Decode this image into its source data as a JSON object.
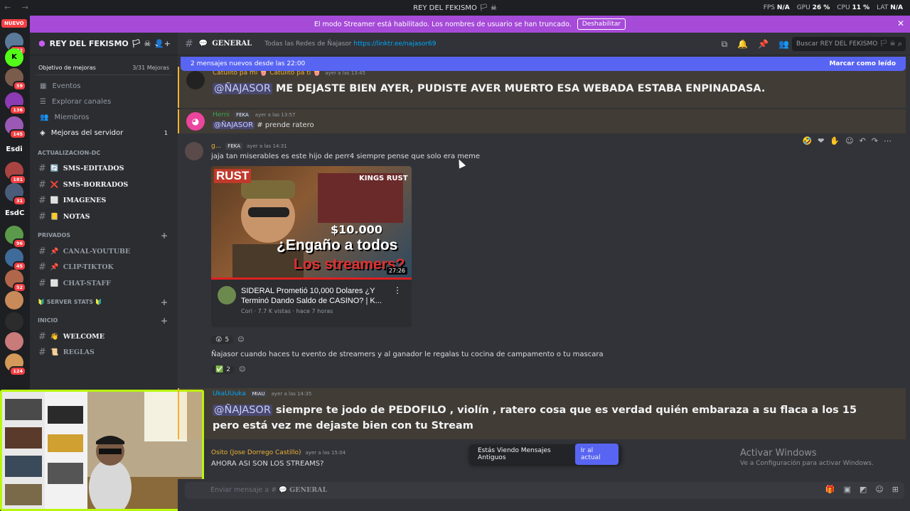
{
  "window": {
    "title": "REY DEL FEKISMO 🏳 ☠",
    "nav": "← →",
    "stats": [
      {
        "k": "FPS",
        "v": "N/A"
      },
      {
        "k": "GPU",
        "v": "26 %"
      },
      {
        "k": "CPU",
        "v": "11 %"
      },
      {
        "k": "LAT",
        "v": "N/A"
      }
    ]
  },
  "banner": {
    "text": "El modo Streamer está habilitado. Los nombres de usuario se han truncado.",
    "button": "Deshabilitar",
    "close": "✕"
  },
  "guilds": {
    "new_label": "NUEVO",
    "items": [
      {
        "badge": "232",
        "color": "#5b7a9a"
      },
      {
        "badge": "",
        "color": "#53fc18",
        "text": "K"
      },
      {
        "badge": "59",
        "color": "#7a5c4c"
      },
      {
        "badge": "136",
        "color": "#8b3bb3"
      },
      {
        "badge": "145",
        "color": "#9b59b6"
      },
      {
        "badge": "",
        "color": "",
        "text": "Esdi"
      },
      {
        "badge": "181",
        "color": "#a94442"
      },
      {
        "badge": "31",
        "color": "#4b5b7a"
      },
      {
        "badge": "",
        "color": "",
        "text": "EsdC"
      },
      {
        "badge": "96",
        "color": "#5a9a4a"
      },
      {
        "badge": "45",
        "color": "#3f6b9a"
      },
      {
        "badge": "52",
        "color": "#b0664a"
      },
      {
        "badge": "",
        "color": "#c98a5a"
      },
      {
        "badge": "",
        "color": "#2c2c2c"
      },
      {
        "badge": "",
        "color": "#c97a7a"
      },
      {
        "badge": "124",
        "color": "#d49a5a"
      }
    ]
  },
  "sidebar": {
    "server_name": "REY DEL FEKISMO 🏳 ☠",
    "boost_goal": "Objetivo de mejoras",
    "boost_count": "3/31 Mejoras",
    "nav": [
      {
        "label": "Eventos",
        "icon": "calendar-icon",
        "glyph": "▦"
      },
      {
        "label": "Explorar canales",
        "icon": "browse-icon",
        "glyph": "☰"
      },
      {
        "label": "Miembros",
        "icon": "members-icon",
        "glyph": "👥"
      },
      {
        "label": "Mejoras del servidor",
        "icon": "boost-icon",
        "glyph": "◈",
        "count": "1"
      }
    ],
    "categories": [
      {
        "name": "ACTUALIZACION-DC",
        "channels": [
          {
            "name": "SMS-EDITADOS",
            "emoji": "🔄",
            "unread": true
          },
          {
            "name": "SMS-BORRADOS",
            "emoji": "❌",
            "unread": true
          },
          {
            "name": "IMAGENES",
            "emoji": "⬜",
            "unread": true
          },
          {
            "name": "NOTAS",
            "emoji": "📒",
            "unread": true
          }
        ]
      },
      {
        "name": "PRIVADOS",
        "channels": [
          {
            "name": "CANAL-YOUTUBE",
            "emoji": "📌",
            "unread": false
          },
          {
            "name": "CLIP-TIKTOK",
            "emoji": "📌",
            "unread": false
          },
          {
            "name": "CHAT-STAFF",
            "emoji": "⬜",
            "unread": false
          }
        ]
      },
      {
        "name": "🔰 SERVER STATS 🔰",
        "channels": []
      },
      {
        "name": "INICIO",
        "channels": [
          {
            "name": "WELCOME",
            "emoji": "👋",
            "unread": true
          },
          {
            "name": "REGLAS",
            "emoji": "📜",
            "unread": false
          }
        ]
      }
    ]
  },
  "header": {
    "channel": "GENERAL",
    "topic": "Todas las Redes de Ñajasor",
    "link": "https://linktr.ee/najasor69",
    "search": "Buscar REY DEL FEKISMO 🏳 ☠"
  },
  "new_messages": {
    "text": "2 mensajes nuevos desde las 22:00",
    "action": "Marcar como leído"
  },
  "messages": [
    {
      "author": "Catulito pa mi 🍿 Catulito pa ti 🍿",
      "time": "ayer a las 13:45",
      "mention": "@ÑAJASOR",
      "text": "ME DEJASTE BIEN AYER, PUDISTE AVER MUERTO ESA WEBADA ESTABA ENPINADASA."
    },
    {
      "author": "Herni",
      "tag": "FEKA",
      "time": "ayer a las 13:57",
      "mention": "@ÑAJASOR",
      "text": "# prende ratero"
    },
    {
      "author": "g...",
      "tag": "FEKA",
      "time": "ayer a las 14:31",
      "text": "jaja tan miserables es este hijo de perr4 siempre pense que solo era meme"
    },
    {
      "text": "Ñajasor cuando haces tu evento de streamers y al ganador le regalas tu cocina de campamento o tu mascara"
    },
    {
      "author": "UkaUUuka",
      "tag": "MIAU",
      "time": "ayer a las 14:35",
      "mention": "@ÑAJASOR",
      "text": "siempre te jodo de PEDOFILO , violín , ratero cosa que es verdad quién embaraza a su flaca a los 15 pero está vez me dejaste bien con tu Stream"
    },
    {
      "author": "Osito (Jose Dorrego Castillo)",
      "time": "ayer a las 15:04",
      "text": "AHORA ASI SON LOS STREAMS?"
    }
  ],
  "embed": {
    "thumb_logo": "RUST",
    "thumb_kings": "KINGS RUST",
    "thumb_price": "$10.000",
    "thumb_line1": "¿Engaño a todos",
    "thumb_line2": "Los streamers?",
    "duration": "27:26",
    "title": "SIDERAL Prometió 10,000 Dolares ¿Y Terminó Dando Saldo de CASINO? | K...",
    "meta": "Cori · 7.7 K vistas · hace 7 horas"
  },
  "reactions1": [
    {
      "emoji": "😲",
      "count": "5"
    }
  ],
  "reactions2": [
    {
      "emoji": "✅",
      "count": "2"
    }
  ],
  "old_banner": {
    "text": "Estás Viendo Mensajes Antiguos",
    "button": "Ir al actual"
  },
  "watermark": {
    "line1": "Activar Windows",
    "line2": "Ve a Configuración para activar Windows."
  },
  "composer": {
    "placeholder": "Enviar mensaje a #",
    "channel": "GENERAL"
  },
  "colors": {
    "accent": "#5865f2",
    "streamer_banner": "#a64ad8",
    "webcam_border": "#b8f70b"
  }
}
